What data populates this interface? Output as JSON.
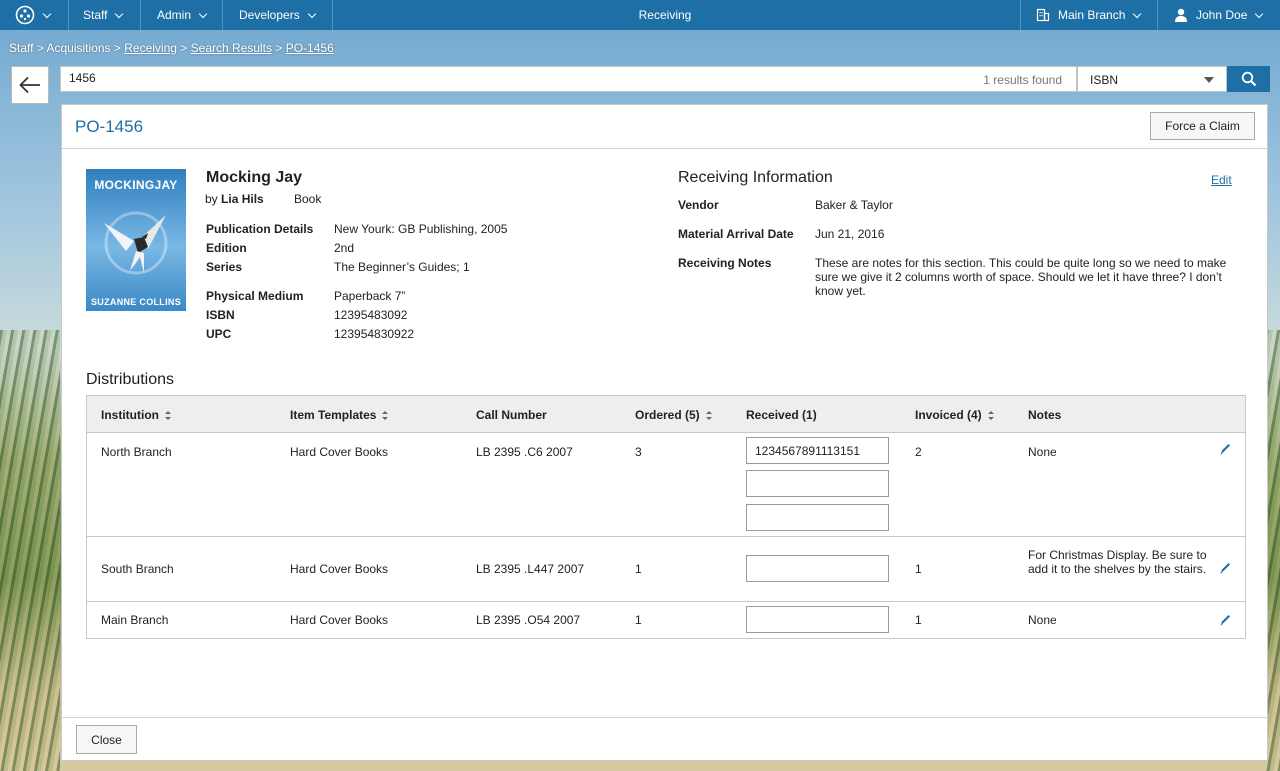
{
  "nav": {
    "menus": [
      "Staff",
      "Admin",
      "Developers"
    ],
    "page_title": "Receiving",
    "branch": "Main Branch",
    "user": "John Doe"
  },
  "breadcrumb": {
    "items": [
      "Staff",
      "Acquisitions",
      "Receiving",
      "Search Results",
      "PO-1456"
    ],
    "separator": ">"
  },
  "search": {
    "value": "1456",
    "result_count": "1 results found",
    "field": "ISBN"
  },
  "po": {
    "title": "PO-1456",
    "force_claim_label": "Force a Claim",
    "close_label": "Close"
  },
  "book": {
    "cover_title": "MOCKINGJAY",
    "cover_author": "SUZANNE COLLINS",
    "title": "Mocking Jay",
    "by": "by",
    "author": "Lia Hils",
    "type": "Book",
    "details": [
      {
        "label": "Publication Details",
        "value": "New Yourk: GB Publishing, 2005"
      },
      {
        "label": "Edition",
        "value": "2nd"
      },
      {
        "label": "Series",
        "value": "The Beginner’s Guides; 1"
      },
      {
        "label": "Physical Medium",
        "value": "Paperback 7”"
      },
      {
        "label": "ISBN",
        "value": "12395483092"
      },
      {
        "label": "UPC",
        "value": "123954830922"
      }
    ]
  },
  "receiving": {
    "title": "Receiving Information",
    "edit_label": "Edit",
    "vendor_label": "Vendor",
    "vendor": "Baker & Taylor",
    "arrival_label": "Material Arrival Date",
    "arrival": "Jun 21, 2016",
    "notes_label": "Receiving Notes",
    "notes": "These are notes for this section.  This could be quite long so we need to make sure we give it 2 columns worth of space.  Should we let it have three?  I don’t know yet."
  },
  "distributions": {
    "title": "Distributions",
    "columns": [
      "Institution",
      "Item Templates",
      "Call Number",
      "Ordered (5)",
      "Received (1)",
      "Invoiced (4)",
      "Notes"
    ],
    "rows": [
      {
        "institution": "North Branch",
        "template": "Hard Cover Books",
        "call_number": "LB 2395 .C6 2007",
        "ordered": "3",
        "received": [
          "1234567891113151",
          "",
          ""
        ],
        "invoiced": "2",
        "notes": "None"
      },
      {
        "institution": "South Branch",
        "template": "Hard Cover Books",
        "call_number": "LB 2395 .L447 2007",
        "ordered": "1",
        "received": [
          ""
        ],
        "invoiced": "1",
        "notes": "For Christmas Display.  Be sure to add it to the shelves by the stairs."
      },
      {
        "institution": "Main Branch",
        "template": "Hard Cover Books",
        "call_number": "LB 2395 .O54 2007",
        "ordered": "1",
        "received": [
          ""
        ],
        "invoiced": "1",
        "notes": "None"
      }
    ]
  },
  "colors": {
    "brand": "#1d6fa5",
    "link": "#1d6fa5"
  },
  "icons": [
    "app-logo-icon",
    "back-arrow-icon",
    "search-icon",
    "building-icon",
    "user-icon",
    "pencil-icon",
    "sort-icon",
    "chevron-down-icon"
  ]
}
